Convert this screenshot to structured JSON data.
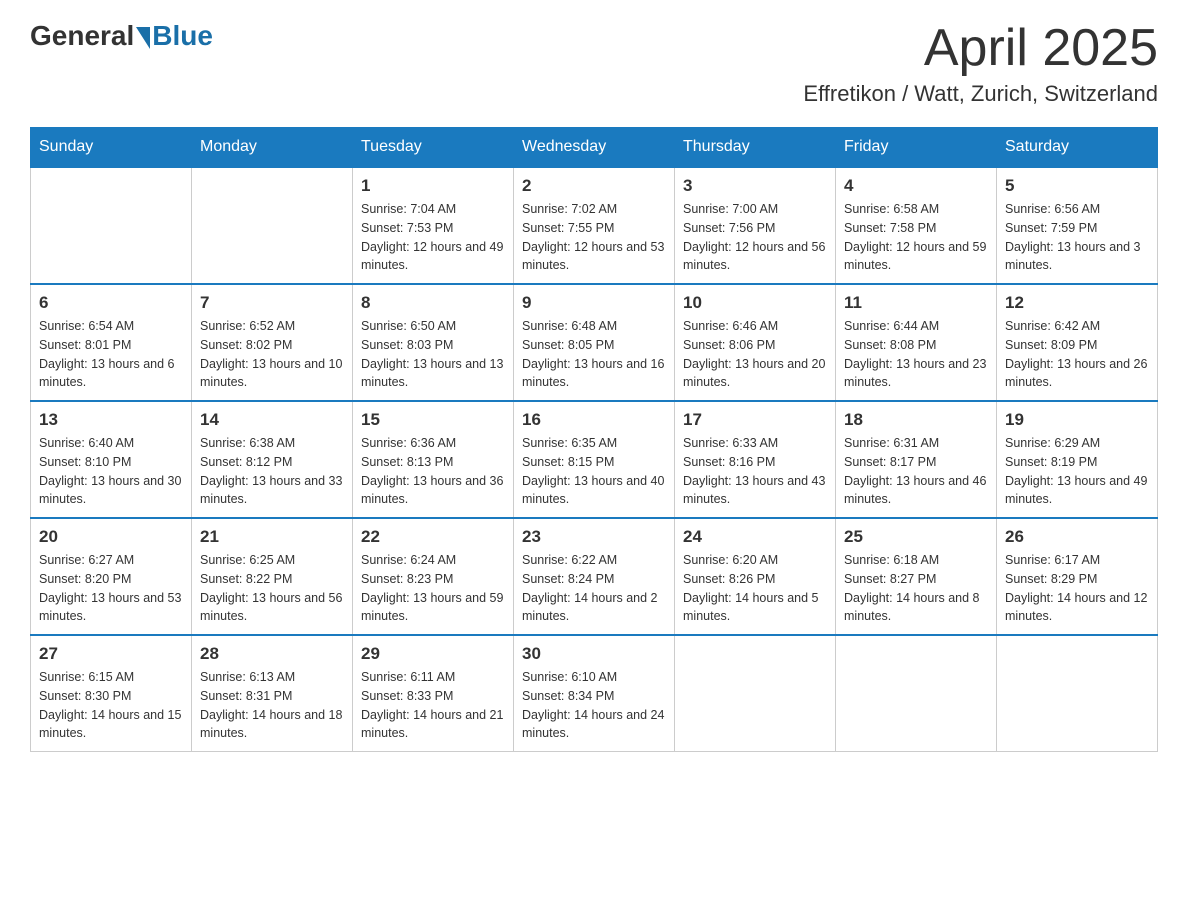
{
  "header": {
    "logo_general": "General",
    "logo_blue": "Blue",
    "month_title": "April 2025",
    "location": "Effretikon / Watt, Zurich, Switzerland"
  },
  "weekdays": [
    "Sunday",
    "Monday",
    "Tuesday",
    "Wednesday",
    "Thursday",
    "Friday",
    "Saturday"
  ],
  "weeks": [
    [
      {
        "day": "",
        "sunrise": "",
        "sunset": "",
        "daylight": ""
      },
      {
        "day": "",
        "sunrise": "",
        "sunset": "",
        "daylight": ""
      },
      {
        "day": "1",
        "sunrise": "Sunrise: 7:04 AM",
        "sunset": "Sunset: 7:53 PM",
        "daylight": "Daylight: 12 hours and 49 minutes."
      },
      {
        "day": "2",
        "sunrise": "Sunrise: 7:02 AM",
        "sunset": "Sunset: 7:55 PM",
        "daylight": "Daylight: 12 hours and 53 minutes."
      },
      {
        "day": "3",
        "sunrise": "Sunrise: 7:00 AM",
        "sunset": "Sunset: 7:56 PM",
        "daylight": "Daylight: 12 hours and 56 minutes."
      },
      {
        "day": "4",
        "sunrise": "Sunrise: 6:58 AM",
        "sunset": "Sunset: 7:58 PM",
        "daylight": "Daylight: 12 hours and 59 minutes."
      },
      {
        "day": "5",
        "sunrise": "Sunrise: 6:56 AM",
        "sunset": "Sunset: 7:59 PM",
        "daylight": "Daylight: 13 hours and 3 minutes."
      }
    ],
    [
      {
        "day": "6",
        "sunrise": "Sunrise: 6:54 AM",
        "sunset": "Sunset: 8:01 PM",
        "daylight": "Daylight: 13 hours and 6 minutes."
      },
      {
        "day": "7",
        "sunrise": "Sunrise: 6:52 AM",
        "sunset": "Sunset: 8:02 PM",
        "daylight": "Daylight: 13 hours and 10 minutes."
      },
      {
        "day": "8",
        "sunrise": "Sunrise: 6:50 AM",
        "sunset": "Sunset: 8:03 PM",
        "daylight": "Daylight: 13 hours and 13 minutes."
      },
      {
        "day": "9",
        "sunrise": "Sunrise: 6:48 AM",
        "sunset": "Sunset: 8:05 PM",
        "daylight": "Daylight: 13 hours and 16 minutes."
      },
      {
        "day": "10",
        "sunrise": "Sunrise: 6:46 AM",
        "sunset": "Sunset: 8:06 PM",
        "daylight": "Daylight: 13 hours and 20 minutes."
      },
      {
        "day": "11",
        "sunrise": "Sunrise: 6:44 AM",
        "sunset": "Sunset: 8:08 PM",
        "daylight": "Daylight: 13 hours and 23 minutes."
      },
      {
        "day": "12",
        "sunrise": "Sunrise: 6:42 AM",
        "sunset": "Sunset: 8:09 PM",
        "daylight": "Daylight: 13 hours and 26 minutes."
      }
    ],
    [
      {
        "day": "13",
        "sunrise": "Sunrise: 6:40 AM",
        "sunset": "Sunset: 8:10 PM",
        "daylight": "Daylight: 13 hours and 30 minutes."
      },
      {
        "day": "14",
        "sunrise": "Sunrise: 6:38 AM",
        "sunset": "Sunset: 8:12 PM",
        "daylight": "Daylight: 13 hours and 33 minutes."
      },
      {
        "day": "15",
        "sunrise": "Sunrise: 6:36 AM",
        "sunset": "Sunset: 8:13 PM",
        "daylight": "Daylight: 13 hours and 36 minutes."
      },
      {
        "day": "16",
        "sunrise": "Sunrise: 6:35 AM",
        "sunset": "Sunset: 8:15 PM",
        "daylight": "Daylight: 13 hours and 40 minutes."
      },
      {
        "day": "17",
        "sunrise": "Sunrise: 6:33 AM",
        "sunset": "Sunset: 8:16 PM",
        "daylight": "Daylight: 13 hours and 43 minutes."
      },
      {
        "day": "18",
        "sunrise": "Sunrise: 6:31 AM",
        "sunset": "Sunset: 8:17 PM",
        "daylight": "Daylight: 13 hours and 46 minutes."
      },
      {
        "day": "19",
        "sunrise": "Sunrise: 6:29 AM",
        "sunset": "Sunset: 8:19 PM",
        "daylight": "Daylight: 13 hours and 49 minutes."
      }
    ],
    [
      {
        "day": "20",
        "sunrise": "Sunrise: 6:27 AM",
        "sunset": "Sunset: 8:20 PM",
        "daylight": "Daylight: 13 hours and 53 minutes."
      },
      {
        "day": "21",
        "sunrise": "Sunrise: 6:25 AM",
        "sunset": "Sunset: 8:22 PM",
        "daylight": "Daylight: 13 hours and 56 minutes."
      },
      {
        "day": "22",
        "sunrise": "Sunrise: 6:24 AM",
        "sunset": "Sunset: 8:23 PM",
        "daylight": "Daylight: 13 hours and 59 minutes."
      },
      {
        "day": "23",
        "sunrise": "Sunrise: 6:22 AM",
        "sunset": "Sunset: 8:24 PM",
        "daylight": "Daylight: 14 hours and 2 minutes."
      },
      {
        "day": "24",
        "sunrise": "Sunrise: 6:20 AM",
        "sunset": "Sunset: 8:26 PM",
        "daylight": "Daylight: 14 hours and 5 minutes."
      },
      {
        "day": "25",
        "sunrise": "Sunrise: 6:18 AM",
        "sunset": "Sunset: 8:27 PM",
        "daylight": "Daylight: 14 hours and 8 minutes."
      },
      {
        "day": "26",
        "sunrise": "Sunrise: 6:17 AM",
        "sunset": "Sunset: 8:29 PM",
        "daylight": "Daylight: 14 hours and 12 minutes."
      }
    ],
    [
      {
        "day": "27",
        "sunrise": "Sunrise: 6:15 AM",
        "sunset": "Sunset: 8:30 PM",
        "daylight": "Daylight: 14 hours and 15 minutes."
      },
      {
        "day": "28",
        "sunrise": "Sunrise: 6:13 AM",
        "sunset": "Sunset: 8:31 PM",
        "daylight": "Daylight: 14 hours and 18 minutes."
      },
      {
        "day": "29",
        "sunrise": "Sunrise: 6:11 AM",
        "sunset": "Sunset: 8:33 PM",
        "daylight": "Daylight: 14 hours and 21 minutes."
      },
      {
        "day": "30",
        "sunrise": "Sunrise: 6:10 AM",
        "sunset": "Sunset: 8:34 PM",
        "daylight": "Daylight: 14 hours and 24 minutes."
      },
      {
        "day": "",
        "sunrise": "",
        "sunset": "",
        "daylight": ""
      },
      {
        "day": "",
        "sunrise": "",
        "sunset": "",
        "daylight": ""
      },
      {
        "day": "",
        "sunrise": "",
        "sunset": "",
        "daylight": ""
      }
    ]
  ]
}
